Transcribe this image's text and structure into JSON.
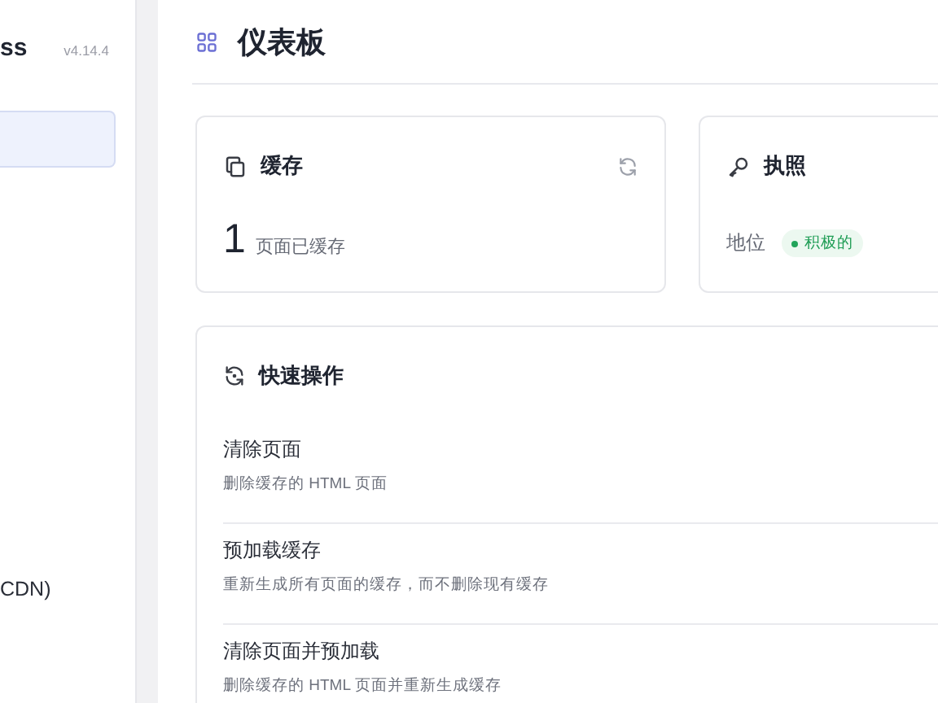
{
  "sidebar": {
    "brand": "ss",
    "version": "v4.14.4",
    "items": [
      {
        "selected": true
      },
      {
        "label": "CDN)",
        "selected": false
      }
    ]
  },
  "header": {
    "title": "仪表板"
  },
  "cache_card": {
    "title": "缓存",
    "count": "1",
    "count_label": "页面已缓存"
  },
  "license_card": {
    "title": "执照",
    "status_label": "地位",
    "status": "积极的"
  },
  "quick_actions": {
    "title": "快速操作",
    "actions": [
      {
        "title": "清除页面",
        "description": "删除缓存的 HTML 页面"
      },
      {
        "title": "预加载缓存",
        "description": "重新生成所有页面的缓存，而不删除现有缓存"
      },
      {
        "title": "清除页面并预加载",
        "description": "删除缓存的 HTML 页面并重新生成缓存"
      }
    ]
  }
}
